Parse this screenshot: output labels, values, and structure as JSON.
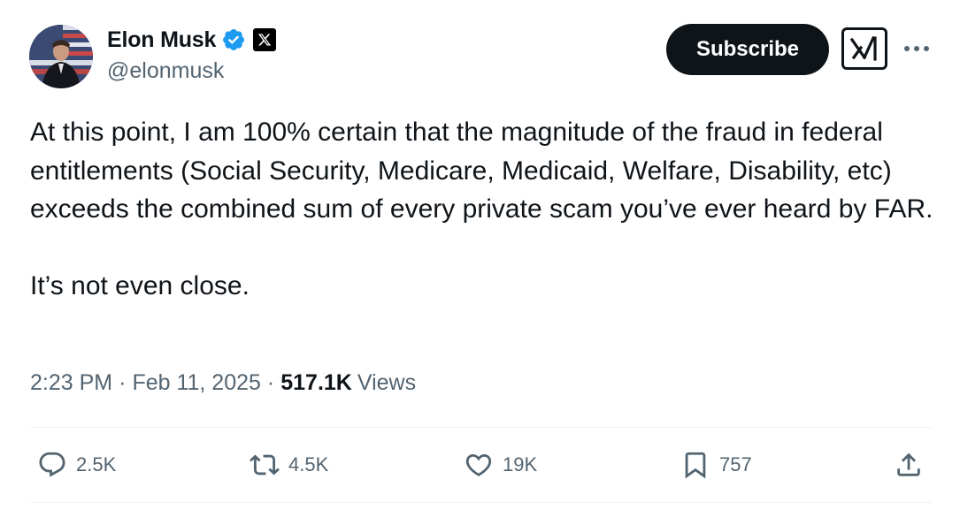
{
  "author": {
    "display_name": "Elon Musk",
    "handle": "@elonmusk",
    "verified_icon": "verified-badge-icon",
    "affiliation_icon": "x-logo-icon"
  },
  "header": {
    "subscribe_label": "Subscribe",
    "grok_icon": "grok-icon",
    "more_icon": "more-icon"
  },
  "tweet": {
    "text": "At this point, I am 100% certain that the magnitude of the fraud in federal entitlements (Social Security, Medicare, Medicaid, Welfare, Disability, etc) exceeds the combined sum of every private scam you’ve ever heard by FAR.\n\nIt’s not even close."
  },
  "meta": {
    "time": "2:23 PM",
    "separator": "·",
    "date": "Feb 11, 2025",
    "views_count": "517.1K",
    "views_label": "Views"
  },
  "actions": {
    "replies": "2.5K",
    "reposts": "4.5K",
    "likes": "19K",
    "bookmarks": "757"
  },
  "colors": {
    "text": "#0f1419",
    "secondary": "#536471",
    "verified": "#1d9bf0",
    "divider": "#eff3f4"
  }
}
